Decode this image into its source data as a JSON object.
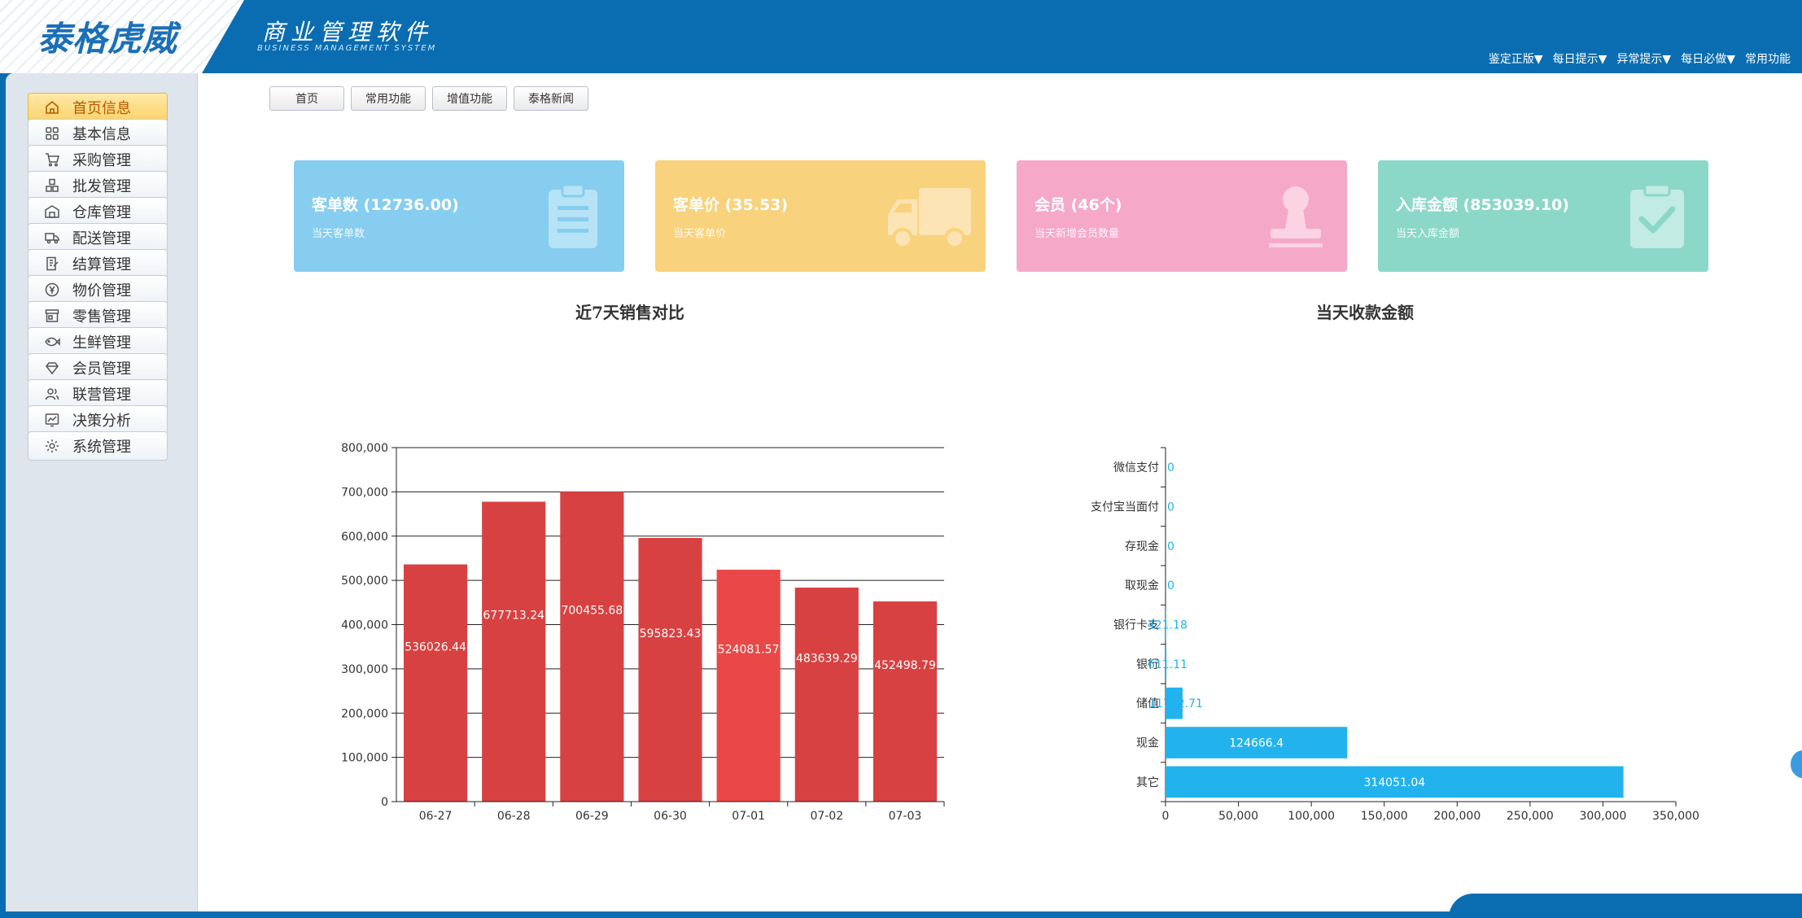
{
  "header": {
    "logo": "泰格虎威",
    "title": "商业管理软件",
    "subtitle": "BUSINESS MANAGEMENT SYSTEM",
    "menu": [
      "鉴定正版▼",
      "每日提示▼",
      "异常提示▼",
      "每日必做▼",
      "常用功能"
    ]
  },
  "sidebar": {
    "items": [
      {
        "label": "首页信息",
        "icon": "home-icon"
      },
      {
        "label": "基本信息",
        "icon": "grid-icon"
      },
      {
        "label": "采购管理",
        "icon": "cart-icon"
      },
      {
        "label": "批发管理",
        "icon": "boxes-icon"
      },
      {
        "label": "仓库管理",
        "icon": "warehouse-icon"
      },
      {
        "label": "配送管理",
        "icon": "truck-icon"
      },
      {
        "label": "结算管理",
        "icon": "invoice-icon"
      },
      {
        "label": "物价管理",
        "icon": "yen-icon"
      },
      {
        "label": "零售管理",
        "icon": "store-icon"
      },
      {
        "label": "生鲜管理",
        "icon": "fish-icon"
      },
      {
        "label": "会员管理",
        "icon": "diamond-icon"
      },
      {
        "label": "联营管理",
        "icon": "users-icon"
      },
      {
        "label": "决策分析",
        "icon": "analysis-icon"
      },
      {
        "label": "系统管理",
        "icon": "gear-icon"
      }
    ]
  },
  "tabs": [
    "首页",
    "常用功能",
    "增值功能",
    "泰格新闻"
  ],
  "kpis": [
    {
      "title": "客单数 (12736.00)",
      "sub": "当天客单数",
      "color": "#87cdf0",
      "icon": "clipboard-icon"
    },
    {
      "title": "客单价 (35.53)",
      "sub": "当天客单价",
      "color": "#f8d27d",
      "icon": "truck-icon"
    },
    {
      "title": "会员 (46个)",
      "sub": "当天新增会员数量",
      "color": "#f6a8c8",
      "icon": "stamp-icon"
    },
    {
      "title": "入库金额 (853039.10)",
      "sub": "当天入库金额",
      "color": "#8bd8c9",
      "icon": "checklist-icon"
    }
  ],
  "chart_data": [
    {
      "type": "bar",
      "title": "近7天销售对比",
      "categories": [
        "06-27",
        "06-28",
        "06-29",
        "06-30",
        "07-01",
        "07-02",
        "07-03"
      ],
      "values": [
        536026.44,
        677713.24,
        700455.68,
        595823.43,
        524081.57,
        483639.29,
        452498.79
      ],
      "data_labels": [
        "536026.44",
        "677713.24",
        "700455.68",
        "595823.43",
        "524081.57",
        "483639.29",
        "452498.79"
      ],
      "ylim": [
        0,
        800000
      ],
      "yticks": [
        "800,000",
        "700,000",
        "600,000",
        "500,000",
        "400,000",
        "300,000",
        "200,000",
        "100,000",
        "0"
      ],
      "grid": true,
      "colors": [
        "#d84141",
        "#d84141",
        "#d84141",
        "#d84141",
        "#ea4848",
        "#d84141",
        "#d84141"
      ]
    },
    {
      "type": "bar",
      "orientation": "horizontal",
      "title": "当天收款金额",
      "categories": [
        "微信支付",
        "支付宝当面付",
        "存现金",
        "取现金",
        "银行卡支付",
        "银行",
        "储值",
        "现金",
        "其它"
      ],
      "category_labels": [
        "微信支付",
        "支付宝当面付",
        "存现金",
        "取现金",
        "银行卡支",
        "银行",
        "储值",
        "现金",
        "其它"
      ],
      "values": [
        0,
        0,
        0,
        0,
        421.18,
        611.11,
        11702.71,
        124666.4,
        314051.04
      ],
      "data_labels": [
        "0",
        "0",
        "0",
        "0",
        "421.18",
        "611.11",
        "11702.71",
        "124666.4",
        "314051.04"
      ],
      "xlim": [
        0,
        350000
      ],
      "xticks": [
        "0",
        "50,000",
        "100,000",
        "150,000",
        "200,000",
        "250,000",
        "300,000",
        "350,000"
      ],
      "color": "#22b3ee"
    }
  ]
}
